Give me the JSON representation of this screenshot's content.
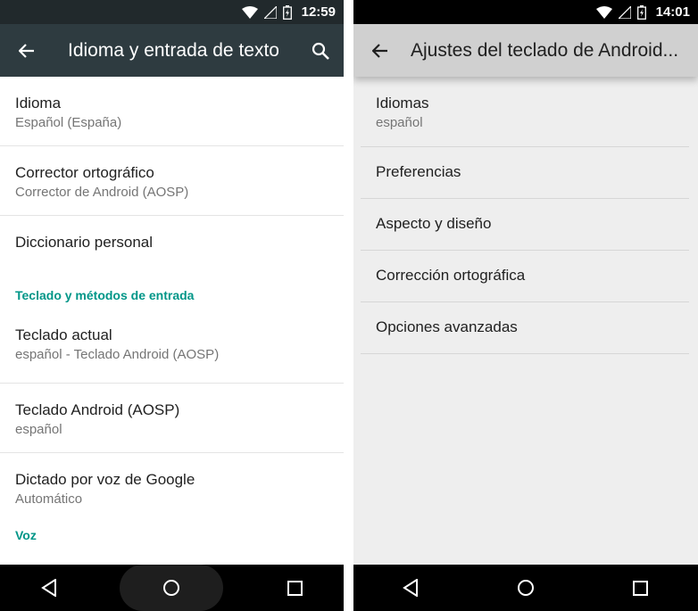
{
  "left_screen": {
    "status": {
      "time": "12:59"
    },
    "toolbar": {
      "title": "Idioma y entrada de texto"
    },
    "items": [
      {
        "title": "Idioma",
        "subtitle": "Español (España)"
      },
      {
        "title": "Corrector ortográfico",
        "subtitle": "Corrector de Android (AOSP)"
      },
      {
        "title": "Diccionario personal"
      }
    ],
    "section_keyboard": "Teclado y métodos de entrada",
    "keyboard_items": [
      {
        "title": "Teclado actual",
        "subtitle": "español - Teclado Android (AOSP)"
      },
      {
        "title": "Teclado Android (AOSP)",
        "subtitle": "español"
      },
      {
        "title": "Dictado por voz de Google",
        "subtitle": "Automático"
      }
    ],
    "section_voice": "Voz"
  },
  "right_screen": {
    "status": {
      "time": "14:01"
    },
    "toolbar": {
      "title": "Ajustes del teclado de Android..."
    },
    "items": [
      {
        "title": "Idiomas",
        "subtitle": "español"
      },
      {
        "title": "Preferencias"
      },
      {
        "title": "Aspecto y diseño"
      },
      {
        "title": "Corrección ortográfica"
      },
      {
        "title": "Opciones avanzadas"
      }
    ]
  },
  "colors": {
    "accent": "#009688",
    "toolbar_dark": "#2e3b40",
    "statusbar_dark": "#21292c",
    "toolbar_light": "#d0d0d0",
    "background_light": "#eeeeee"
  },
  "icons": [
    "back-arrow-icon",
    "search-icon",
    "wifi-icon",
    "signal-icon",
    "battery-icon",
    "nav-back-icon",
    "nav-home-icon",
    "nav-recents-icon"
  ]
}
